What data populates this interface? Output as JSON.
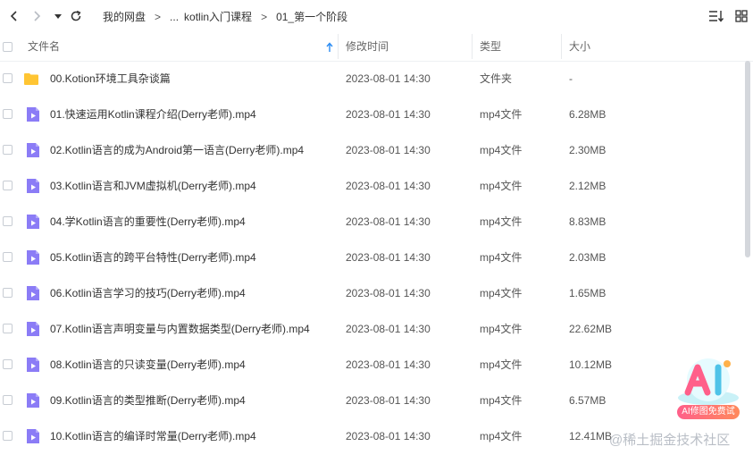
{
  "toolbar": {
    "back_icon": "chevron-left-icon",
    "forward_icon": "chevron-right-icon",
    "history_icon": "caret-down-icon",
    "refresh_icon": "refresh-icon",
    "breadcrumb": [
      "我的网盘",
      "...",
      "kotlin入门课程",
      "01_第一个阶段"
    ],
    "breadcrumb_sep": ">",
    "sort_icon": "sort-list-icon",
    "grid_icon": "grid-view-icon"
  },
  "columns": {
    "name": "文件名",
    "modified": "修改时间",
    "type": "类型",
    "size": "大小",
    "sort_icon": "arrow-up-icon"
  },
  "rows": [
    {
      "name": "00.Kotion环境工具杂谈篇",
      "modified": "2023-08-01 14:30",
      "type": "文件夹",
      "size": "-",
      "icon": "folder-icon"
    },
    {
      "name": "01.快速运用Kotlin课程介绍(Derry老师).mp4",
      "modified": "2023-08-01 14:30",
      "type": "mp4文件",
      "size": "6.28MB",
      "icon": "video-file-icon"
    },
    {
      "name": "02.Kotlin语言的成为Android第一语言(Derry老师).mp4",
      "modified": "2023-08-01 14:30",
      "type": "mp4文件",
      "size": "2.30MB",
      "icon": "video-file-icon"
    },
    {
      "name": "03.Kotlin语言和JVM虚拟机(Derry老师).mp4",
      "modified": "2023-08-01 14:30",
      "type": "mp4文件",
      "size": "2.12MB",
      "icon": "video-file-icon"
    },
    {
      "name": "04.学Kotlin语言的重要性(Derry老师).mp4",
      "modified": "2023-08-01 14:30",
      "type": "mp4文件",
      "size": "8.83MB",
      "icon": "video-file-icon"
    },
    {
      "name": "05.Kotlin语言的跨平台特性(Derry老师).mp4",
      "modified": "2023-08-01 14:30",
      "type": "mp4文件",
      "size": "2.03MB",
      "icon": "video-file-icon"
    },
    {
      "name": "06.Kotlin语言学习的技巧(Derry老师).mp4",
      "modified": "2023-08-01 14:30",
      "type": "mp4文件",
      "size": "1.65MB",
      "icon": "video-file-icon"
    },
    {
      "name": "07.Kotlin语言声明变量与内置数据类型(Derry老师).mp4",
      "modified": "2023-08-01 14:30",
      "type": "mp4文件",
      "size": "22.62MB",
      "icon": "video-file-icon"
    },
    {
      "name": "08.Kotlin语言的只读变量(Derry老师).mp4",
      "modified": "2023-08-01 14:30",
      "type": "mp4文件",
      "size": "10.12MB",
      "icon": "video-file-icon"
    },
    {
      "name": "09.Kotlin语言的类型推断(Derry老师).mp4",
      "modified": "2023-08-01 14:30",
      "type": "mp4文件",
      "size": "6.57MB",
      "icon": "video-file-icon"
    },
    {
      "name": "10.Kotlin语言的编译时常量(Derry老师).mp4",
      "modified": "2023-08-01 14:30",
      "type": "mp4文件",
      "size": "12.41MB",
      "icon": "video-file-icon"
    }
  ],
  "ai_badge": {
    "label": "AI修图免费试",
    "icon": "ai-logo-icon"
  },
  "watermark": "@稀土掘金技术社区",
  "colors": {
    "accent": "#2b8cf3",
    "folder": "#ffc533",
    "video": "#8b7cf6",
    "divider": "#e8eaed"
  }
}
